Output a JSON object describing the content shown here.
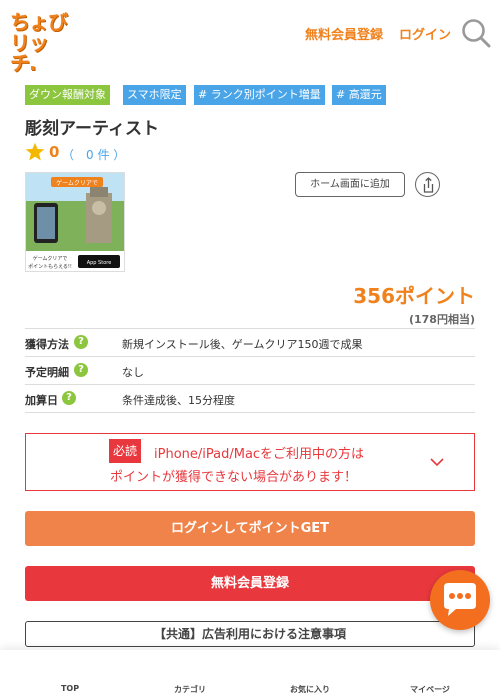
{
  "header": {
    "logo_line1": "ちょび",
    "logo_line2": "リッチ.",
    "register_label": "無料会員登録",
    "login_label": "ログイン",
    "search_icon": "search-icon"
  },
  "tags": [
    "ダウン報酬対象",
    "スマホ限定",
    "# ランク別ポイント増量",
    "# 高還元"
  ],
  "title": "彫刻アーティスト",
  "rating": {
    "score": "0",
    "count": "（　0 件 ）"
  },
  "thumbnail": {
    "banner_text": "ゲームクリアで",
    "caption_line1": "ゲームクリアで",
    "caption_line2": "ポイントもらえる!!",
    "store_label": "App Store"
  },
  "home_button_label": "ホーム画面に追加",
  "points": {
    "value": "356ポイント",
    "yen": "(178円相当)"
  },
  "info_rows": [
    {
      "label": "獲得方法",
      "value": "新規インストール後、ゲームクリア150週で成果"
    },
    {
      "label": "予定明細",
      "value": "なし"
    },
    {
      "label": "加算日",
      "value": "条件達成後、15分程度"
    }
  ],
  "notice": {
    "badge": "必読",
    "line1": "iPhone/iPad/Macをご利用中の方は",
    "line2": "ポイントが獲得できない場合があります！"
  },
  "buttons": {
    "login_get": "ログインしてポイントGET",
    "register": "無料会員登録",
    "caution": "【共通】広告利用における注意事項"
  },
  "bottom_nav": [
    "TOP",
    "カテゴリ",
    "お気に入り",
    "マイページ"
  ],
  "colors": {
    "brand_orange": "#f0821e",
    "tag_green": "#8cc63f",
    "tag_blue": "#4aa5e8",
    "alert_red": "#e8383d",
    "login_button": "#f0834a",
    "chat_button": "#f36e1e"
  }
}
